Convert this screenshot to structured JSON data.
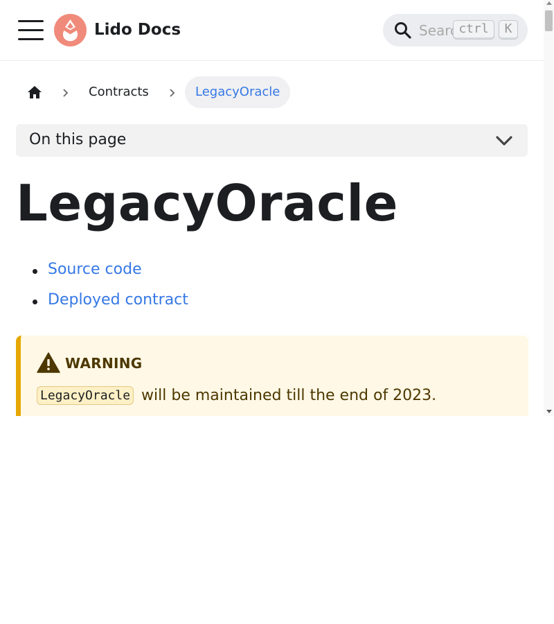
{
  "navbar": {
    "brand": "Lido Docs",
    "search_placeholder": "Search",
    "kbd_ctrl": "ctrl",
    "kbd_k": "K",
    "logo_color": "#f08a7a"
  },
  "breadcrumbs": {
    "items": [
      {
        "label": "Contracts"
      },
      {
        "label": "LegacyOracle"
      }
    ]
  },
  "toc": {
    "label": "On this page"
  },
  "page": {
    "title": "LegacyOracle",
    "links": [
      {
        "label": "Source code"
      },
      {
        "label": "Deployed contract"
      }
    ]
  },
  "admonition": {
    "title": "WARNING",
    "code": "LegacyOracle",
    "text": "will be maintained till the end of 2023."
  },
  "colors": {
    "link": "#3578e5",
    "warning_border": "#e6a700",
    "warning_bg": "#fff8e6"
  }
}
